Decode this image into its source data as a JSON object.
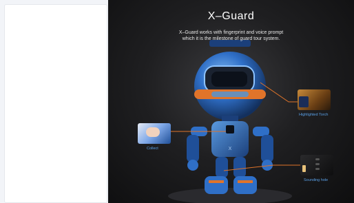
{
  "hero": {
    "title": "X–Guard",
    "subtitle_line1": "X–Guard works with fingerprint and voice prompt",
    "subtitle_line2": "which it is the milestone of guard tour system."
  },
  "callouts": {
    "torch": "Highlighted Torch",
    "collect": "Collect",
    "sound": "Sounding hole"
  },
  "colors": {
    "accent": "#e0742a",
    "robot_blue": "#2f6fc7",
    "label_blue": "#5aa0e6"
  }
}
